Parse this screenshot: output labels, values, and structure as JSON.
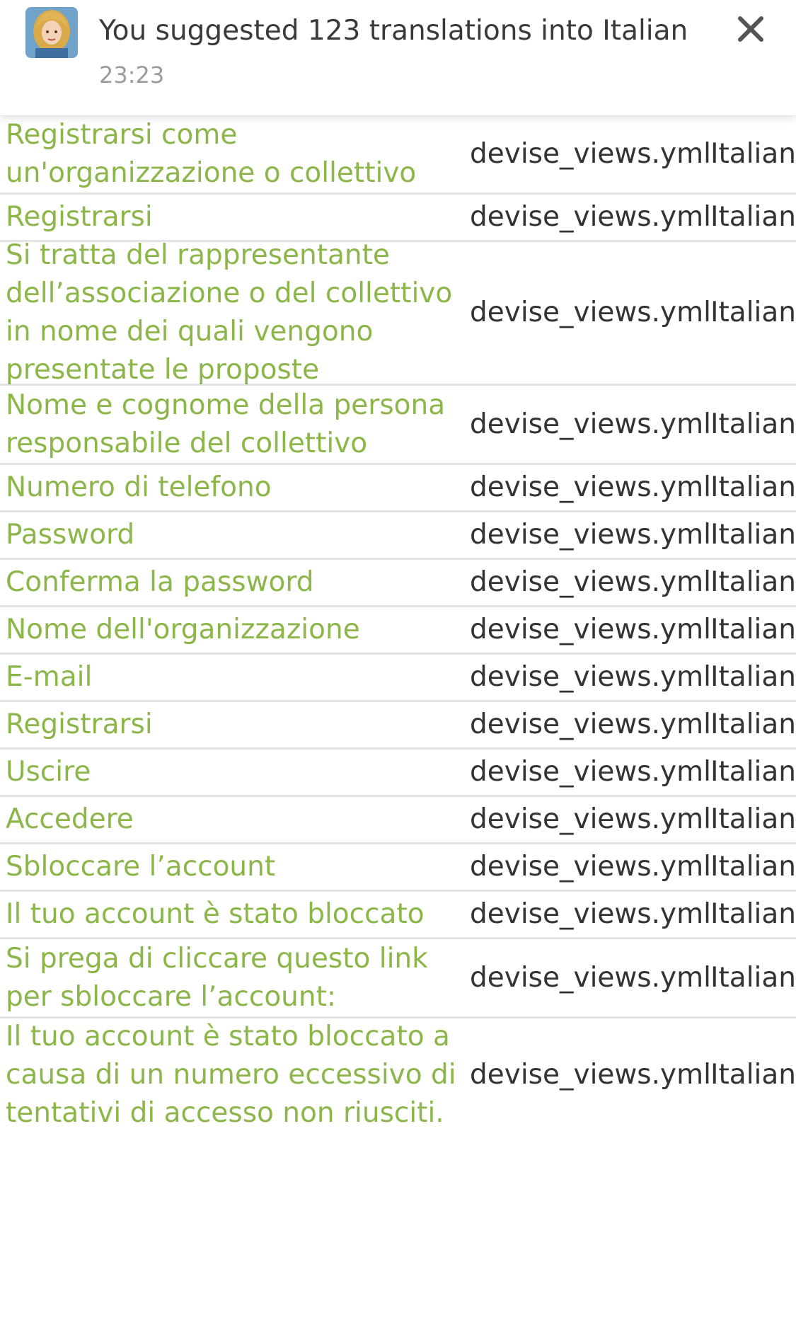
{
  "notification": {
    "title": "You suggested 123 translations into Italian",
    "time": "23:23",
    "avatar_icon": "user-avatar-icon",
    "close_icon": "close-icon"
  },
  "colors": {
    "link_green": "#8cb64a",
    "text_dark": "#333333",
    "muted": "#9b9b9b",
    "divider": "#e2e2e2"
  },
  "rows": [
    {
      "text": "Registrarsi come un'organizzazione o collettivo",
      "file": "devise_views.yml",
      "language": "Italian"
    },
    {
      "text": "Registrarsi",
      "file": "devise_views.yml",
      "language": "Italian"
    },
    {
      "text": "Si tratta del rappresentante dell’associazione o del collettivo in nome dei quali vengono presentate le proposte",
      "file": "devise_views.yml",
      "language": "Italian"
    },
    {
      "text": "Nome e cognome della persona responsabile del collettivo",
      "file": "devise_views.yml",
      "language": "Italian"
    },
    {
      "text": "Numero di telefono",
      "file": "devise_views.yml",
      "language": "Italian"
    },
    {
      "text": "Password",
      "file": "devise_views.yml",
      "language": "Italian"
    },
    {
      "text": "Conferma la password",
      "file": "devise_views.yml",
      "language": "Italian"
    },
    {
      "text": "Nome dell'organizzazione",
      "file": "devise_views.yml",
      "language": "Italian"
    },
    {
      "text": "E-mail",
      "file": "devise_views.yml",
      "language": "Italian"
    },
    {
      "text": "Registrarsi",
      "file": "devise_views.yml",
      "language": "Italian"
    },
    {
      "text": "Uscire",
      "file": "devise_views.yml",
      "language": "Italian"
    },
    {
      "text": "Accedere",
      "file": "devise_views.yml",
      "language": "Italian"
    },
    {
      "text": "Sbloccare l’account",
      "file": "devise_views.yml",
      "language": "Italian"
    },
    {
      "text": "Il tuo account è stato bloccato",
      "file": "devise_views.yml",
      "language": "Italian"
    },
    {
      "text": "Si prega di cliccare questo link per sbloccare l’account:",
      "file": "devise_views.yml",
      "language": "Italian"
    },
    {
      "text": "Il tuo account è stato bloccato a causa di un numero eccessivo di tentativi di accesso non riusciti.",
      "file": "devise_views.yml",
      "language": "Italian"
    }
  ]
}
